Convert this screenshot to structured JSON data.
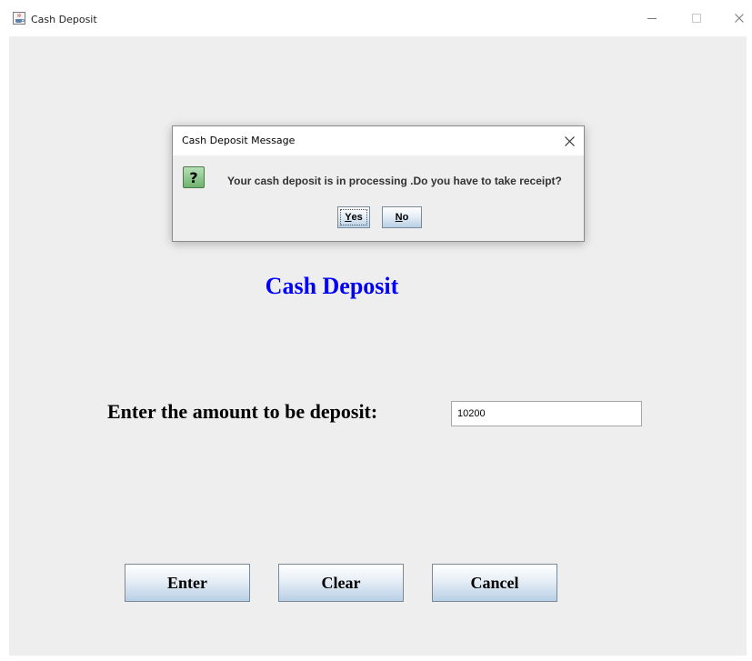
{
  "window": {
    "title": "Cash Deposit",
    "icons": {
      "app": "java-cup-icon",
      "minimize": "minimize-icon",
      "maximize": "maximize-icon",
      "close": "close-icon"
    }
  },
  "form": {
    "heading": "Cash Deposit",
    "amount_label": "Enter the amount to be deposit:",
    "amount_value": "10200",
    "buttons": {
      "enter": "Enter",
      "clear": "Clear",
      "cancel": "Cancel"
    }
  },
  "dialog": {
    "title": "Cash Deposit Message",
    "icon": "question-icon",
    "message": "Your cash deposit is in processing .Do you have to take receipt?",
    "yes_first": "Y",
    "yes_rest": "es",
    "no_first": "N",
    "no_rest": "o"
  },
  "colors": {
    "heading": "#0000ff",
    "client_bg": "#eeeeee"
  }
}
